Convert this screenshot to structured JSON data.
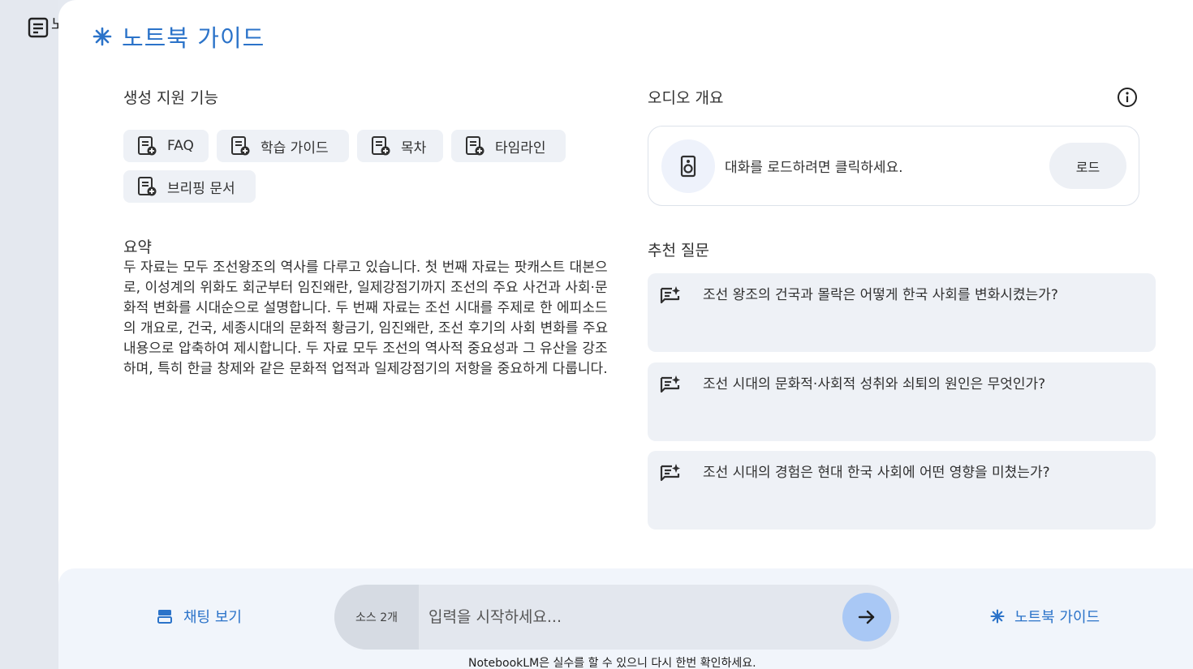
{
  "rail": {
    "peek_text": "노"
  },
  "header": {
    "title": "노트북 가이드"
  },
  "features": {
    "title": "생성 지원 기능",
    "chips": [
      {
        "label": "FAQ"
      },
      {
        "label": "학습 가이드"
      },
      {
        "label": "목차"
      },
      {
        "label": "타임라인"
      },
      {
        "label": "브리핑 문서"
      }
    ]
  },
  "summary": {
    "title": "요약",
    "body": "두 자료는 모두 조선왕조의 역사를 다루고 있습니다. 첫 번째 자료는 팟캐스트 대본으로, 이성계의 위화도 회군부터 임진왜란, 일제강점기까지 조선의 주요 사건과 사회·문화적 변화를 시대순으로 설명합니다. 두 번째 자료는 조선 시대를 주제로 한 에피소드의 개요로, 건국, 세종시대의 문화적 황금기, 임진왜란, 조선 후기의 사회 변화를 주요 내용으로 압축하여 제시합니다. 두 자료 모두 조선의 역사적 중요성과 그 유산을 강조하며, 특히 한글 창제와 같은 문화적 업적과 일제강점기의 저항을 중요하게 다룹니다."
  },
  "audio": {
    "title": "오디오 개요",
    "prompt": "대화를 로드하려면 클릭하세요.",
    "load_label": "로드"
  },
  "suggested": {
    "title": "추천 질문",
    "questions": [
      {
        "text": "조선 왕조의 건국과 몰락은 어떻게 한국 사회를 변화시켰는가?"
      },
      {
        "text": "조선 시대의 문화적·사회적 성취와 쇠퇴의 원인은 무엇인가?"
      },
      {
        "text": "조선 시대의 경험은 현대 한국 사회에 어떤 영향을 미쳤는가?"
      }
    ]
  },
  "bottom": {
    "chat_view_label": "채팅 보기",
    "source_count": "소스 2개",
    "input_placeholder": "입력을 시작하세요...",
    "guide_label": "노트북 가이드",
    "disclaimer": "NotebookLM은 실수를 할 수 있으니 다시 한번 확인하세요."
  },
  "colors": {
    "accent": "#2b73c9",
    "chip_bg": "#eef1f6",
    "send_bg": "#a9c8f5"
  },
  "icons": {
    "rail": "notes-icon",
    "header": "sparkle-icon",
    "chip": "doc-add-icon",
    "info": "info-icon",
    "audio": "speaker-icon",
    "question": "note-sparkle-icon",
    "chat": "chat-icon",
    "send": "arrow-right-icon"
  }
}
